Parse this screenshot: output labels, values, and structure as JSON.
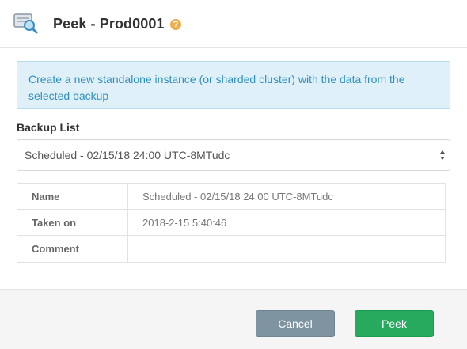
{
  "header": {
    "title": "Peek - Prod0001",
    "icon": "database-search-icon",
    "help": "?"
  },
  "info": {
    "text": "Create a new standalone instance (or sharded cluster) with the data from the selected backup"
  },
  "backup_list": {
    "label": "Backup List",
    "selected": "Scheduled - 02/15/18 24:00 UTC-8MTudc"
  },
  "details": {
    "rows": [
      {
        "key": "Name",
        "value": "Scheduled - 02/15/18 24:00 UTC-8MTudc"
      },
      {
        "key": "Taken on",
        "value": "2018-2-15 5:40:46"
      },
      {
        "key": "Comment",
        "value": ""
      }
    ]
  },
  "footer": {
    "cancel_label": "Cancel",
    "peek_label": "Peek"
  },
  "colors": {
    "info_bg": "#dff0f8",
    "info_text": "#2f8fc1",
    "help_icon": "#f0ad4e",
    "cancel_button": "#7f94a1",
    "peek_button": "#27a95e"
  }
}
